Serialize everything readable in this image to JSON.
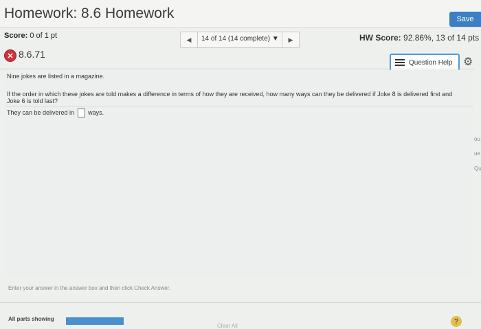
{
  "header": {
    "title": "Homework: 8.6 Homework",
    "save_label": "Save"
  },
  "score_bar": {
    "score_label": "Score:",
    "score_value": "0 of 1 pt",
    "nav_text": "14 of 14 (14 complete) ▼",
    "hw_score_label": "HW Score:",
    "hw_score_value": "92.86%, 13 of 14 pts"
  },
  "question": {
    "number": "8.6.71",
    "status": "incorrect",
    "help_label": "Question Help",
    "text1": "Nine jokes are listed in a magazine.",
    "text2": "If the order in which these jokes are told makes a difference in terms of how they are received, how many ways can they be delivered if Joke 8 is delivered first and Joke 6 is told last?",
    "answer_prefix": "They can be delivered in",
    "answer_value": "",
    "answer_suffix": "ways."
  },
  "side_fragments": [
    "ou",
    "ue",
    "Que"
  ],
  "footer": {
    "instruction": "Enter your answer in the answer box and then click Check Answer.",
    "parts_label": "All parts showing",
    "progress_fraction": 1.0,
    "clear_label": "Clear All",
    "help_icon": "?"
  },
  "colors": {
    "accent": "#3b7fc4",
    "incorrect": "#d3303d",
    "help_border": "#4b9bd8",
    "progress": "#4a90cf"
  },
  "icons": {
    "wrong": "x-circle-icon",
    "prev": "left-triangle-icon",
    "next": "right-triangle-icon",
    "help": "list-icon",
    "settings": "gear-icon",
    "footer_help": "question-circle-icon"
  }
}
